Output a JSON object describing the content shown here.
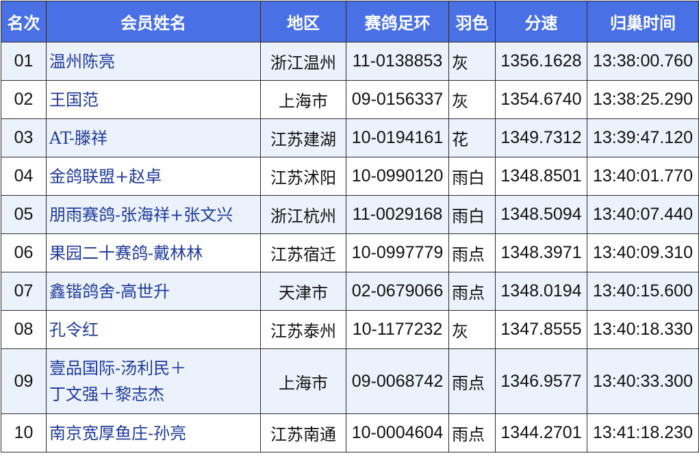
{
  "headers": {
    "rank": "名次",
    "name": "会员姓名",
    "region": "地区",
    "ring": "赛鸽足环",
    "color": "羽色",
    "speed": "分速",
    "time": "归巢时间"
  },
  "rows": [
    {
      "rank": "01",
      "name": [
        "温州陈亮"
      ],
      "region": "浙江温州",
      "ring": "11-0138853",
      "color": "灰",
      "speed": "1356.1628",
      "time": "13:38:00.760"
    },
    {
      "rank": "02",
      "name": [
        "王国范"
      ],
      "region": "上海市",
      "ring": "09-0156337",
      "color": "灰",
      "speed": "1354.6740",
      "time": "13:38:25.290"
    },
    {
      "rank": "03",
      "name": [
        "AT-滕祥"
      ],
      "region": "江苏建湖",
      "ring": "10-0194161",
      "color": "花",
      "speed": "1349.7312",
      "time": "13:39:47.120"
    },
    {
      "rank": "04",
      "name": [
        "金鸽联盟+赵卓"
      ],
      "region": "江苏沭阳",
      "ring": "10-0990120",
      "color": "雨白",
      "speed": "1348.8501",
      "time": "13:40:01.770"
    },
    {
      "rank": "05",
      "name": [
        "朋雨赛鸽-张海祥+张文兴"
      ],
      "region": "浙江杭州",
      "ring": "11-0029168",
      "color": "雨白",
      "speed": "1348.5094",
      "time": "13:40:07.440"
    },
    {
      "rank": "06",
      "name": [
        "果园二十赛鸽-戴林林"
      ],
      "region": "江苏宿迁",
      "ring": "10-0997779",
      "color": "雨点",
      "speed": "1348.3971",
      "time": "13:40:09.310"
    },
    {
      "rank": "07",
      "name": [
        "鑫锴鸽舍-高世升"
      ],
      "region": "天津市",
      "ring": "02-0679066",
      "color": "雨点",
      "speed": "1348.0194",
      "time": "13:40:15.600"
    },
    {
      "rank": "08",
      "name": [
        "孔令红"
      ],
      "region": "江苏泰州",
      "ring": "10-1177232",
      "color": "灰",
      "speed": "1347.8555",
      "time": "13:40:18.330"
    },
    {
      "rank": "09",
      "name": [
        "壹品国际-汤利民＋",
        "丁文强＋黎志杰"
      ],
      "region": "上海市",
      "ring": "09-0068742",
      "color": "雨点",
      "speed": "1346.9577",
      "time": "13:40:33.300"
    },
    {
      "rank": "10",
      "name": [
        "南京宽厚鱼庄-孙亮"
      ],
      "region": "江苏南通",
      "ring": "10-0004604",
      "color": "雨点",
      "speed": "1344.2701",
      "time": "13:41:18.230"
    }
  ],
  "colors": {
    "header_bg": "#4a70e6",
    "header_text": "#ffffff",
    "stripe_bg": "#ebf2fc",
    "name_text": "#1f3a9a",
    "border": "#2a2a2a"
  }
}
